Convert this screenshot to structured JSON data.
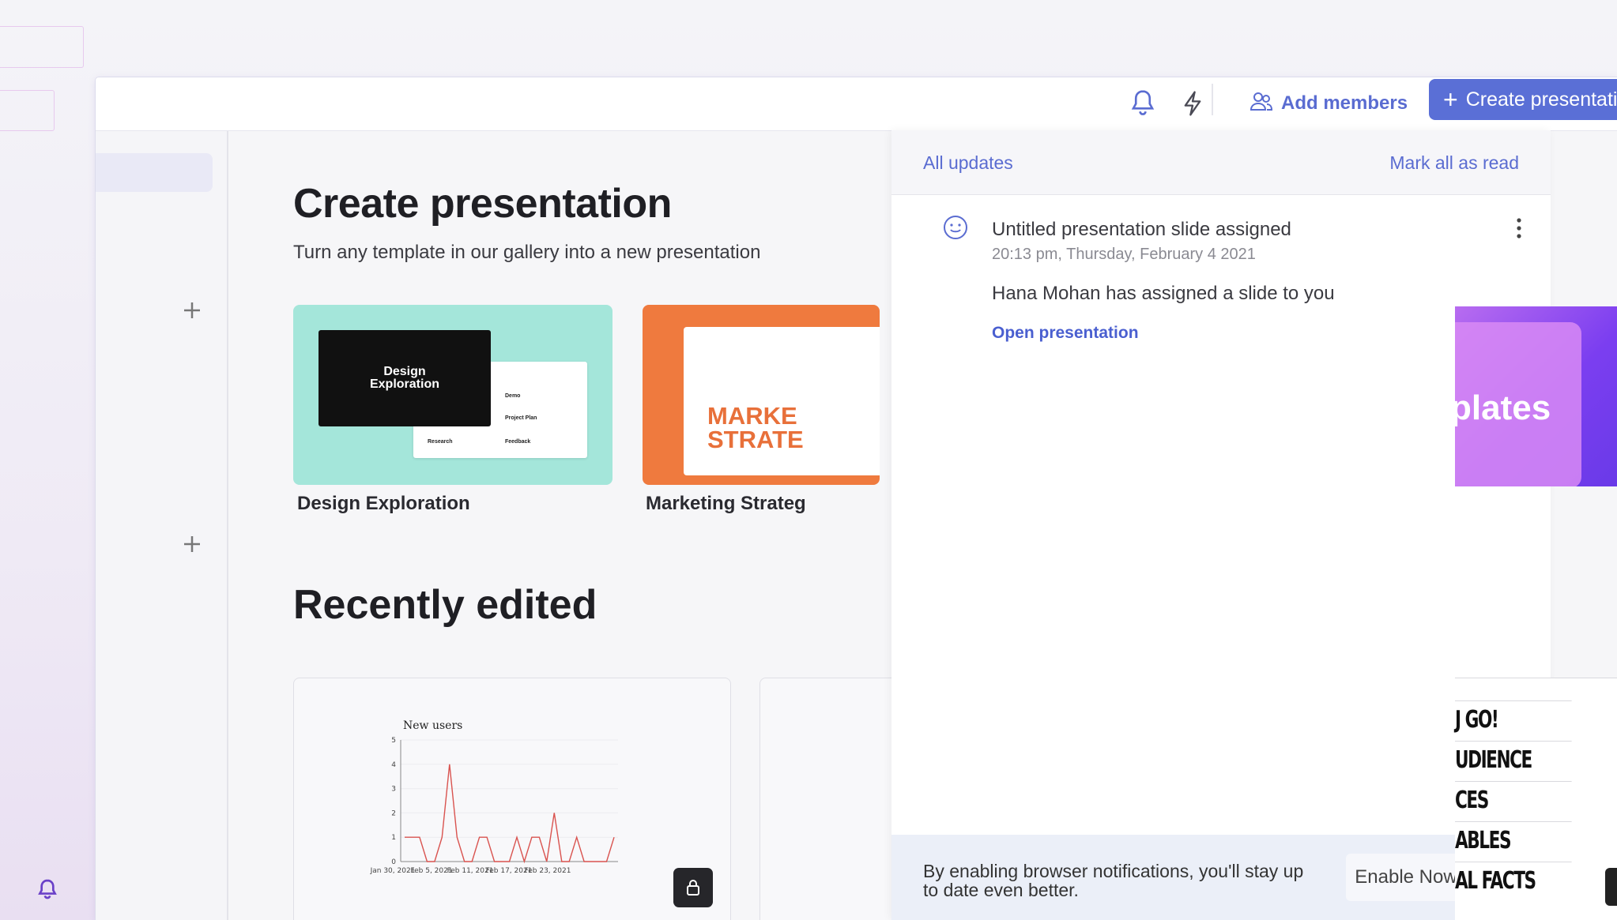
{
  "topbar": {
    "add_members_label": "Add members",
    "create_label": "Create presentati"
  },
  "main": {
    "title": "Create presentation",
    "subtitle": "Turn any template in our gallery into a new presentation",
    "templates": [
      {
        "label": "Design Exploration",
        "thumb_title": "Design Exploration",
        "thumb_items": [
          "Demo",
          "Project Plan",
          "Research",
          "Feedback"
        ],
        "bg": "#a4e6da"
      },
      {
        "label": "Marketing Strateg",
        "thumb_title_line1": "MARKE",
        "thumb_title_line2": "STRATE",
        "bg": "#ef7a3e"
      }
    ],
    "recent_title": "Recently edited",
    "recent_chart": {
      "title": "New users"
    }
  },
  "chart_data": {
    "type": "line",
    "title": "New users",
    "xlabel": "",
    "ylabel": "",
    "x_ticks": [
      "Jan 30, 2021",
      "Feb 5, 2021",
      "Feb 11, 2021",
      "Feb 17, 2021",
      "Feb 23, 2021"
    ],
    "y_ticks": [
      "0",
      "1",
      "2",
      "3",
      "4",
      "5"
    ],
    "ylim": [
      0,
      5
    ],
    "series": [
      {
        "color": "#d9534f",
        "values": [
          1,
          1,
          1,
          0,
          0,
          1,
          4,
          1,
          0,
          0,
          1,
          1,
          0,
          0,
          0,
          1,
          0,
          1,
          1,
          0,
          2,
          0,
          0,
          1,
          0,
          0,
          0,
          0,
          1
        ]
      }
    ],
    "grid": true
  },
  "notifications": {
    "all_updates_label": "All updates",
    "mark_all_read_label": "Mark all as read",
    "items": [
      {
        "title": "Untitled presentation slide assigned",
        "time": "20:13 pm, Thursday, February 4 2021",
        "body": "Hana Mohan has assigned a slide to you",
        "link": "Open presentation"
      }
    ],
    "banner": {
      "text": "By enabling browser notifications, you'll stay up to date even better.",
      "enable_label": "Enable Now"
    }
  },
  "background_right": {
    "promo_text": "plates",
    "poster_lines": [
      "J GO!",
      "UDIENCE",
      "CES",
      "ABLES",
      "AL FACTS"
    ]
  },
  "colors": {
    "accent": "#5a6fd6",
    "link": "#5a6cd1",
    "chart_line": "#d9534f"
  }
}
